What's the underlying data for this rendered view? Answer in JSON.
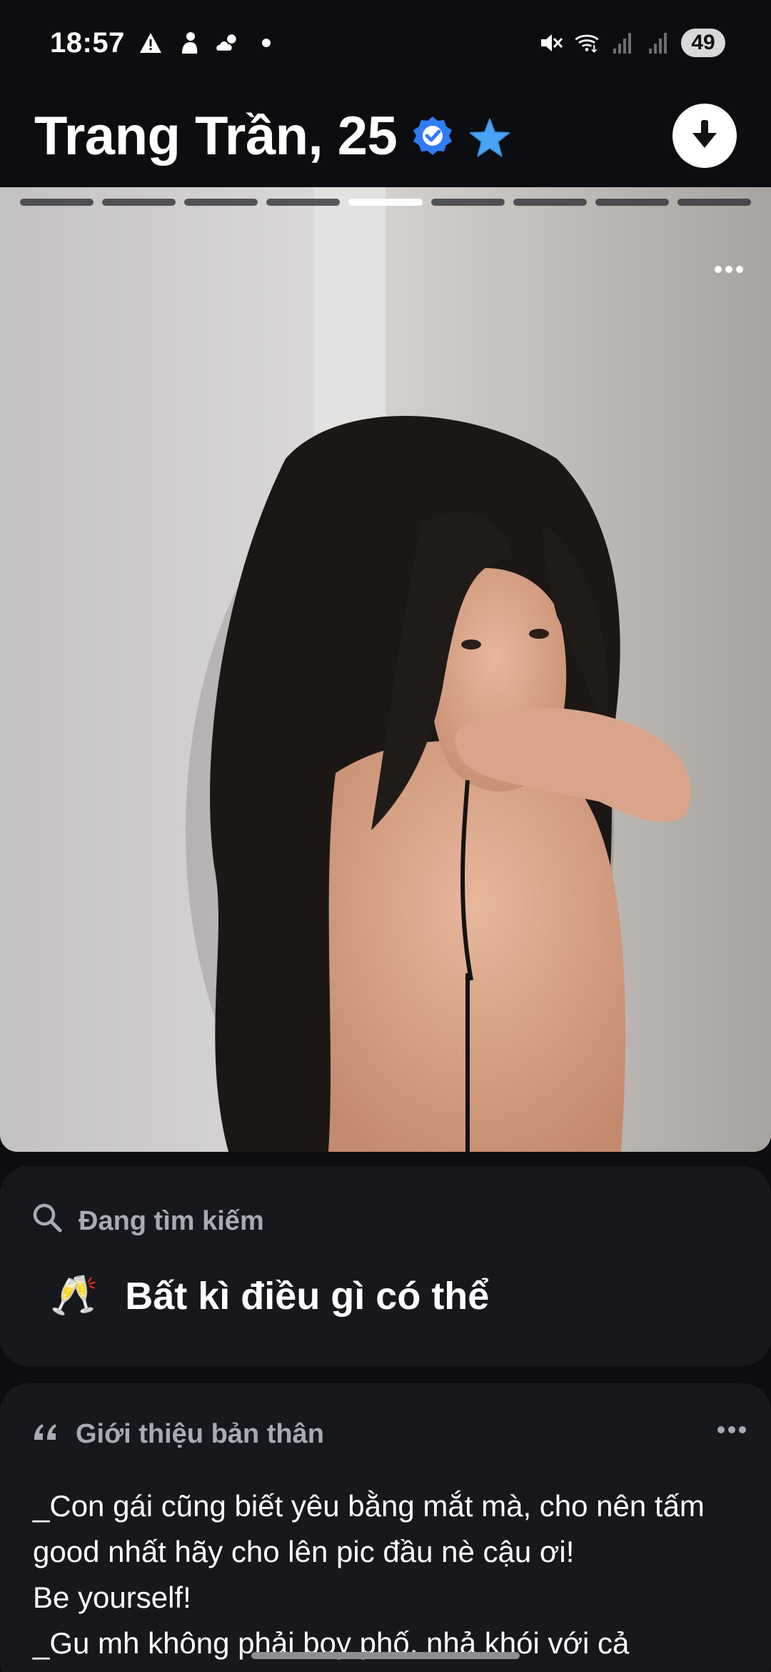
{
  "status_bar": {
    "time": "18:57",
    "battery": "49",
    "icons": [
      "warning-icon",
      "person-icon",
      "cloud-sun-icon",
      "dot-icon",
      "mute-icon",
      "wifi-icon",
      "signal-icon",
      "signal-icon"
    ]
  },
  "header": {
    "name": "Trang Trần, 25",
    "verified_icon": "verified-check-icon",
    "star_icon": "star-icon",
    "collapse_icon": "arrow-down-icon"
  },
  "photo": {
    "total": 9,
    "active_index": 4,
    "more_icon": "more-dots-icon"
  },
  "looking_for": {
    "heading": "Đang tìm kiếm",
    "emoji": "🥂",
    "value": "Bất kì điều gì có thể"
  },
  "about": {
    "heading": "Giới thiệu bản thân",
    "text": "_Con gái cũng biết yêu bằng mắt mà, cho nên tấm good nhất hãy cho lên pic đầu nè cậu ơi!\nBe yourself!\n_Gu mh không phải boy phố, nhả khói với cả"
  },
  "colors": {
    "background": "#0c0d10",
    "card": "#17181d",
    "muted_text": "#a9abb3",
    "verified_blue": "#2f7cf6",
    "star_blue": "#4aa3f5"
  }
}
